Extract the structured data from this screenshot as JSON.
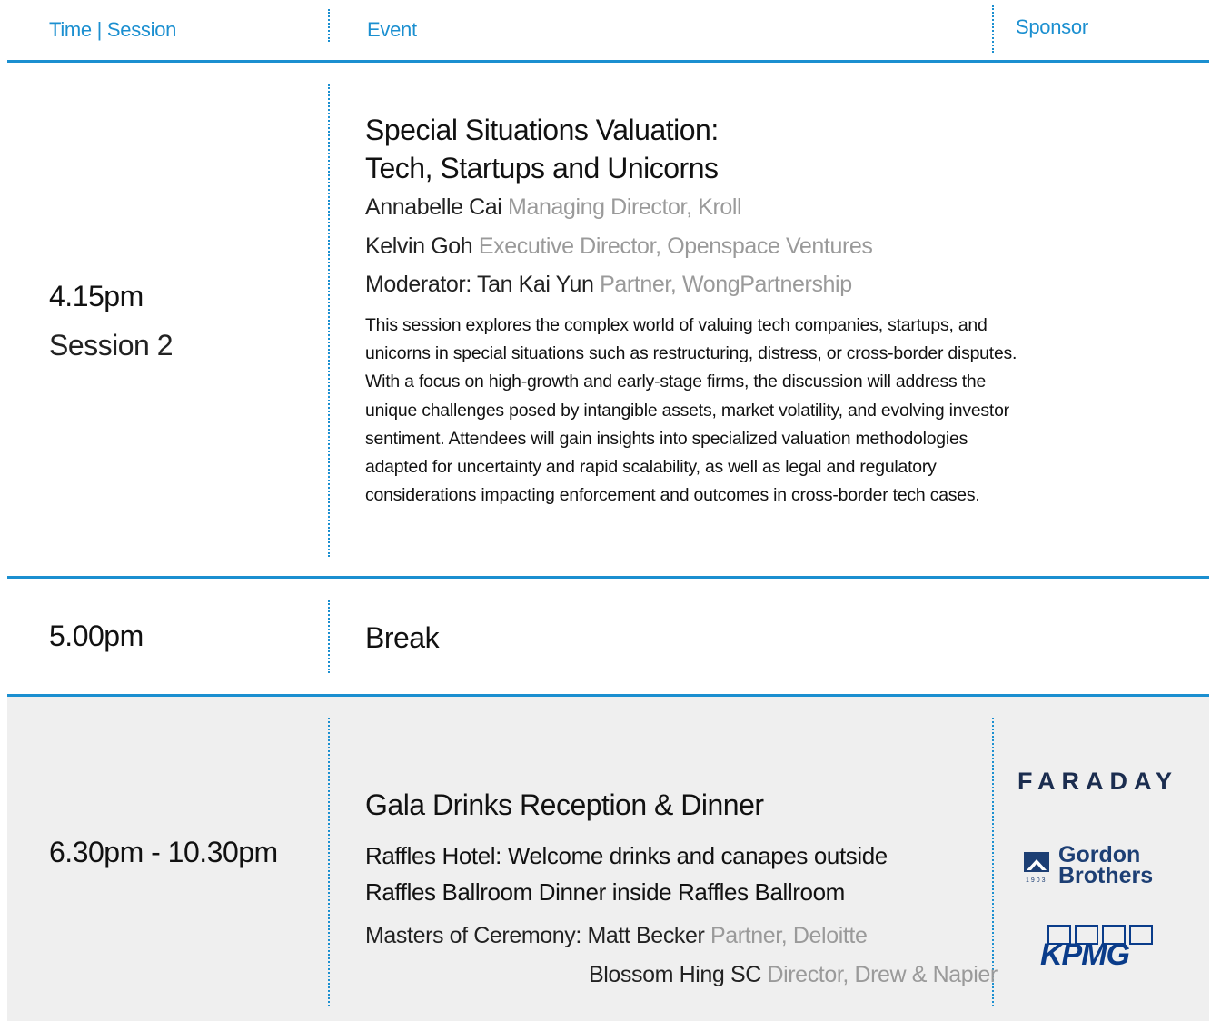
{
  "header": {
    "time_session": "Time | Session",
    "event": "Event",
    "sponsor": "Sponsor"
  },
  "session2": {
    "time": "4.15pm",
    "session": "Session 2",
    "title_line1": "Special Situations Valuation:",
    "title_line2": "Tech, Startups and Unicorns",
    "speakers": [
      {
        "name": "Annabelle Cai",
        "role": "Managing Director, Kroll"
      },
      {
        "name": "Kelvin Goh",
        "role": "Executive Director, Openspace Ventures"
      },
      {
        "name": "Moderator: Tan Kai Yun",
        "role": "Partner, WongPartnership"
      }
    ],
    "description_lines": [
      "This session explores the complex world of valuing tech companies, startups, and",
      "unicorns in special situations such as restructuring, distress, or cross-border disputes.",
      "With a focus on high-growth and early-stage firms, the discussion will address the",
      "unique challenges posed by intangible assets, market volatility, and evolving investor",
      "sentiment. Attendees will gain insights into specialized valuation methodologies",
      "adapted for uncertainty and rapid scalability, as well as legal and regulatory",
      "considerations impacting enforcement and outcomes in cross-border tech cases."
    ]
  },
  "break": {
    "time": "5.00pm",
    "title": "Break"
  },
  "gala": {
    "time": "6.30pm - 10.30pm",
    "title": "Gala Drinks Reception & Dinner",
    "venue_line1": "Raffles Hotel: Welcome drinks and canapes outside",
    "venue_line2": "Raffles Ballroom Dinner inside Raffles Ballroom",
    "mc_label": "Masters of Ceremony:",
    "mcs": [
      {
        "name": "Matt Becker",
        "role": "Partner, Deloitte"
      },
      {
        "name": "Blossom Hing SC",
        "role": "Director, Drew & Napier"
      }
    ],
    "sponsors": {
      "faraday": "FARADAY",
      "gordon_line1": "Gordon",
      "gordon_line2": "Brothers",
      "gordon_year": "1903",
      "kpmg": "KPMG"
    }
  },
  "colors": {
    "accent": "#1b8fd0",
    "muted": "#9a9a9a",
    "gala_bg": "#efefef",
    "faraday": "#1b2d4f",
    "gordon": "#1d3f74",
    "kpmg": "#0a3c8a"
  }
}
